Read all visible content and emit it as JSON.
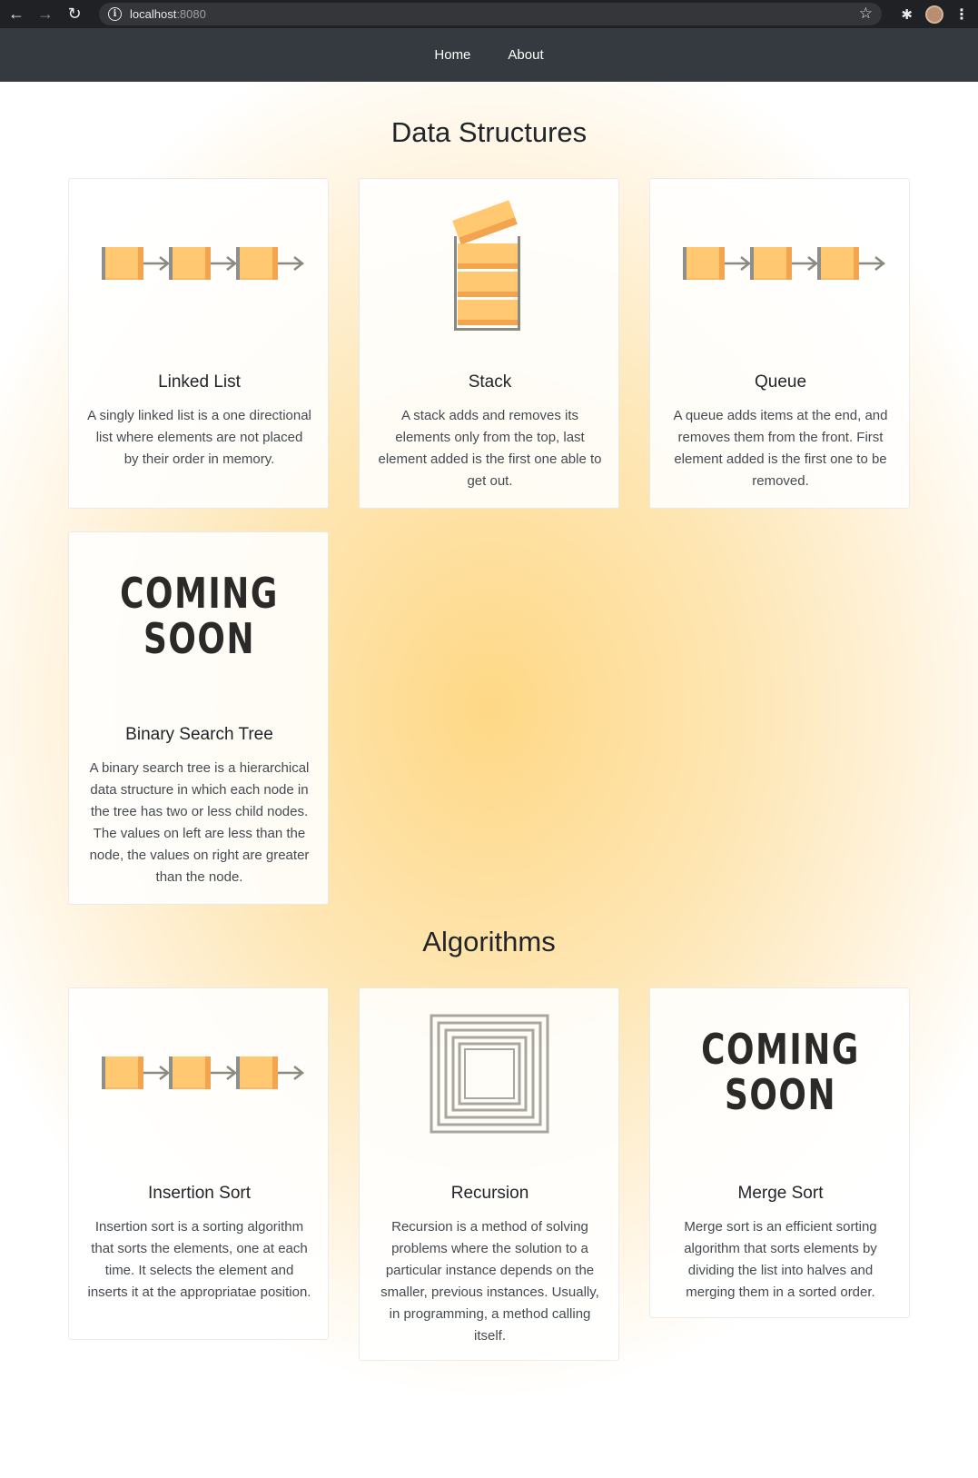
{
  "browser": {
    "url_host": "localhost",
    "url_port": ":8080"
  },
  "nav": {
    "links": [
      "Home",
      "About"
    ]
  },
  "sections": {
    "data_structures": "Data Structures",
    "algorithms": "Algorithms"
  },
  "cards": [
    {
      "title": "Linked List",
      "text": "A singly linked list is a one directional list where elements are not placed by their order in memory.",
      "image": "linked-list-illustration"
    },
    {
      "title": "Stack",
      "text": "A stack adds and removes its elements only from the top, last element added is the first one able to get out.",
      "image": "stack-illustration"
    },
    {
      "title": "Queue",
      "text": "A queue adds items at the end, and removes them from the front. First element added is the first one to be removed.",
      "image": "queue-illustration"
    },
    {
      "title": "Binary Search Tree",
      "text": "A binary search tree is a hierarchical data structure in which each node in the tree has two or less child nodes. The values on left are less than the node, the values on right are greater than the node.",
      "image": "coming-soon-image",
      "badge_line1": "COMING",
      "badge_line2": "SOON"
    },
    {
      "title": "Insertion Sort",
      "text": "Insertion sort is a sorting algorithm that sorts the elements, one at each time. It selects the element and inserts it at the appropriatae position.",
      "image": "insertion-sort-illustration"
    },
    {
      "title": "Recursion",
      "text": "Recursion is a method of solving problems where the solution to a particular instance depends on the smaller, previous instances. Usually, in programming, a method calling itself.",
      "image": "recursion-illustration"
    },
    {
      "title": "Merge Sort",
      "text": "Merge sort is an efficient sorting algorithm that sorts elements by dividing the list into halves and merging them in a sorted order.",
      "image": "coming-soon-image",
      "badge_line1": "COMING",
      "badge_line2": "SOON"
    }
  ],
  "colors": {
    "block_fill": "#ffc46f",
    "block_dark": "#f0a850",
    "arrow": "#8a8a80",
    "nav_bg": "#343a40",
    "page_glow": "#fed886"
  }
}
